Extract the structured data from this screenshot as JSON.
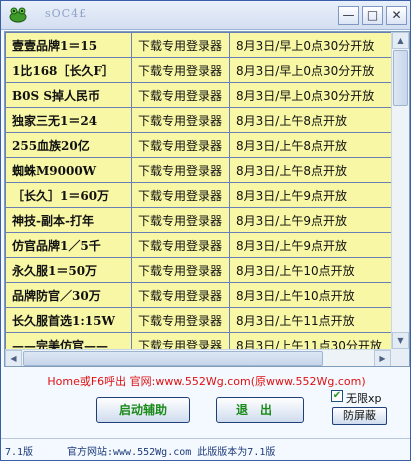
{
  "window": {
    "title": "sOC4£"
  },
  "titlebar_buttons": {
    "minimize": "—",
    "maximize": "□",
    "close": "✕"
  },
  "list": {
    "rows": [
      {
        "name": "壹壹品牌1＝15",
        "type": "下载专用登录器",
        "time": "8月3日/早上0点30分开放"
      },
      {
        "name": "1比168［长久F］",
        "type": "下载专用登录器",
        "time": "8月3日/早上0点30分开放"
      },
      {
        "name": "B0S S掉人民币",
        "type": "下载专用登录器",
        "time": "8月3日/早上0点30分开放"
      },
      {
        "name": "独家三无1＝24",
        "type": "下载专用登录器",
        "time": "8月3日/上午8点开放"
      },
      {
        "name": "255血族20亿",
        "type": "下载专用登录器",
        "time": "8月3日/上午8点开放"
      },
      {
        "name": "蜘蛛M9000W",
        "type": "下载专用登录器",
        "time": "8月3日/上午8点开放"
      },
      {
        "name": "［长久］1＝60万",
        "type": "下载专用登录器",
        "time": "8月3日/上午9点开放"
      },
      {
        "name": "神技-副本-打年",
        "type": "下载专用登录器",
        "time": "8月3日/上午9点开放"
      },
      {
        "name": "仿官品牌1／5千",
        "type": "下载专用登录器",
        "time": "8月3日/上午9点开放"
      },
      {
        "name": "永久服1＝50万",
        "type": "下载专用登录器",
        "time": "8月3日/上午10点开放"
      },
      {
        "name": "品牌防官／30万",
        "type": "下载专用登录器",
        "time": "8月3日/上午10点开放"
      },
      {
        "name": "长久服首选1:15W",
        "type": "下载专用登录器",
        "time": "8月3日/上午11点开放"
      },
      {
        "name": "——完美仿官——",
        "type": "下载专用登录器",
        "time": "8月3日/上午11点30分开放"
      }
    ]
  },
  "scroll": {
    "up": "▲",
    "down": "▼",
    "left": "◀",
    "right": "▶"
  },
  "notice": "Home或F6呼出 官网:www.552Wg.com(原www.552Wg.com)",
  "buttons": {
    "start": "启动辅助",
    "exit": "退出",
    "ban": "防屏蔽"
  },
  "checkbox": {
    "label": "无限xp",
    "checked": true,
    "mark": "✔"
  },
  "status": {
    "version": "7.1版",
    "site": "官方网站:www.552Wg.com  此版版本为7.1版"
  },
  "colors": {
    "row_bg": "#f7f7a5",
    "notice": "#e01010",
    "button_text": "#1a8a1a"
  }
}
